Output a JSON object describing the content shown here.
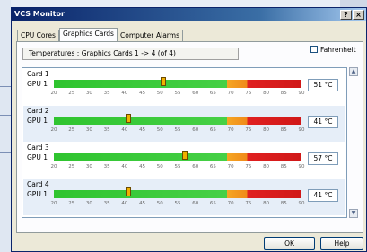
{
  "window": {
    "title": "VCS Monitor",
    "help_glyph": "?",
    "close_glyph": "×"
  },
  "tabs": [
    {
      "label": "CPU Cores"
    },
    {
      "label": "Graphics Cards"
    },
    {
      "label": "Computer"
    },
    {
      "label": "Alarms"
    }
  ],
  "header": "Temperatures : Graphics Cards 1 -> 4 (of 4)",
  "fahrenheit": {
    "label": "Fahrenheit",
    "checked": false
  },
  "scale_ticks": [
    "20",
    "25",
    "30",
    "35",
    "40",
    "45",
    "50",
    "55",
    "60",
    "65",
    "70",
    "75",
    "80",
    "85",
    "90"
  ],
  "cards": [
    {
      "name": "Card 1",
      "gpu": "GPU 1",
      "temp": "51 °C",
      "value": 51
    },
    {
      "name": "Card 2",
      "gpu": "GPU 1",
      "temp": "41 °C",
      "value": 41
    },
    {
      "name": "Card 3",
      "gpu": "GPU 1",
      "temp": "57 °C",
      "value": 57
    },
    {
      "name": "Card 4",
      "gpu": "GPU 1",
      "temp": "41 °C",
      "value": 41
    }
  ],
  "scrollbar": {
    "up_glyph": "▲",
    "down_glyph": "▼"
  },
  "buttons": {
    "ok": "OK",
    "help": "Help"
  },
  "colors": {
    "bar_green": "#46d046",
    "bar_orange": "#f5a623",
    "bar_red": "#e02020",
    "needle": "#f0b000"
  }
}
